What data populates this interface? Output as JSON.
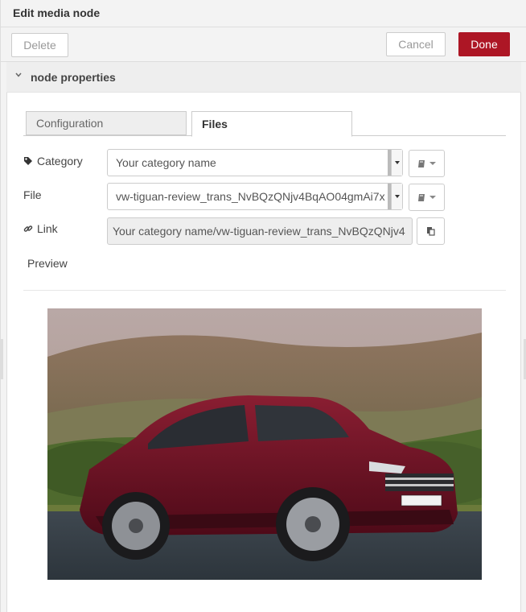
{
  "window": {
    "title": "Edit media node"
  },
  "toolbar": {
    "delete_label": "Delete",
    "cancel_label": "Cancel",
    "done_label": "Done"
  },
  "section": {
    "title": "node properties"
  },
  "tabs": [
    {
      "label": "Configuration",
      "active": false
    },
    {
      "label": "Files",
      "active": true
    }
  ],
  "form": {
    "category_label": "Category",
    "category_value": "Your category name",
    "file_label": "File",
    "file_value": "vw-tiguan-review_trans_NvBQzQNjv4BqAO04gmAi7x",
    "link_label": "Link",
    "link_value": "Your category name/vw-tiguan-review_trans_NvBQzQNjv4",
    "preview_label": "Preview"
  },
  "icons": {
    "category": "tag-icon",
    "link": "link-icon",
    "book": "book-icon",
    "copy": "clipboard-icon",
    "collapse": "chevron-down-icon"
  },
  "colors": {
    "done_button": "#ad1625",
    "background": "#f3f3f3"
  }
}
